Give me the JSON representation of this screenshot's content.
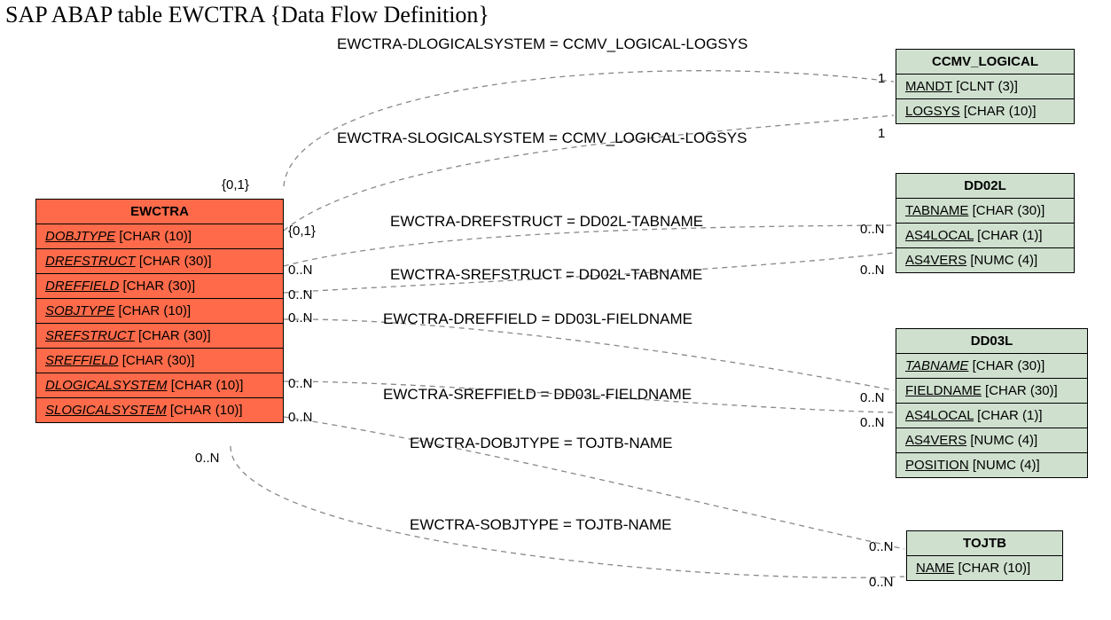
{
  "title": "SAP ABAP table EWCTRA {Data Flow Definition}",
  "entities": {
    "ewctra": {
      "name": "EWCTRA",
      "fields": [
        {
          "name": "DOBJTYPE",
          "type": "[CHAR (10)]"
        },
        {
          "name": "DREFSTRUCT",
          "type": "[CHAR (30)]"
        },
        {
          "name": "DREFFIELD",
          "type": "[CHAR (30)]"
        },
        {
          "name": "SOBJTYPE",
          "type": "[CHAR (10)]"
        },
        {
          "name": "SREFSTRUCT",
          "type": "[CHAR (30)]"
        },
        {
          "name": "SREFFIELD",
          "type": "[CHAR (30)]"
        },
        {
          "name": "DLOGICALSYSTEM",
          "type": "[CHAR (10)]"
        },
        {
          "name": "SLOGICALSYSTEM",
          "type": "[CHAR (10)]"
        }
      ]
    },
    "ccmv": {
      "name": "CCMV_LOGICAL",
      "fields": [
        {
          "name": "MANDT",
          "type": "[CLNT (3)]"
        },
        {
          "name": "LOGSYS",
          "type": "[CHAR (10)]"
        }
      ]
    },
    "dd02l": {
      "name": "DD02L",
      "fields": [
        {
          "name": "TABNAME",
          "type": "[CHAR (30)]"
        },
        {
          "name": "AS4LOCAL",
          "type": "[CHAR (1)]"
        },
        {
          "name": "AS4VERS",
          "type": "[NUMC (4)]"
        }
      ]
    },
    "dd03l": {
      "name": "DD03L",
      "fields": [
        {
          "name": "TABNAME",
          "type": "[CHAR (30)]",
          "ital": true
        },
        {
          "name": "FIELDNAME",
          "type": "[CHAR (30)]"
        },
        {
          "name": "AS4LOCAL",
          "type": "[CHAR (1)]"
        },
        {
          "name": "AS4VERS",
          "type": "[NUMC (4)]"
        },
        {
          "name": "POSITION",
          "type": "[NUMC (4)]"
        }
      ]
    },
    "tojtb": {
      "name": "TOJTB",
      "fields": [
        {
          "name": "NAME",
          "type": "[CHAR (10)]"
        }
      ]
    }
  },
  "relations": {
    "r1": "EWCTRA-DLOGICALSYSTEM = CCMV_LOGICAL-LOGSYS",
    "r2": "EWCTRA-SLOGICALSYSTEM = CCMV_LOGICAL-LOGSYS",
    "r3": "EWCTRA-DREFSTRUCT = DD02L-TABNAME",
    "r4": "EWCTRA-SREFSTRUCT = DD02L-TABNAME",
    "r5": "EWCTRA-DREFFIELD = DD03L-FIELDNAME",
    "r6": "EWCTRA-SREFFIELD = DD03L-FIELDNAME",
    "r7": "EWCTRA-DOBJTYPE = TOJTB-NAME",
    "r8": "EWCTRA-SOBJTYPE = TOJTB-NAME"
  },
  "cards": {
    "c01": "{0,1}",
    "c01b": "{0,1}",
    "c0n": "0..N",
    "c1": "1"
  }
}
